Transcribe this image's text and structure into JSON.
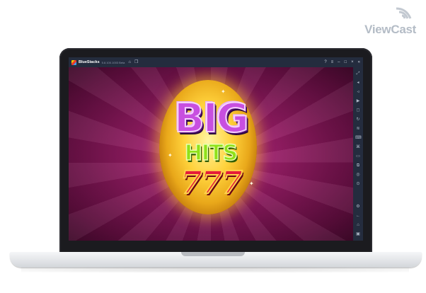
{
  "watermark": {
    "text": "ViewCast"
  },
  "emulator": {
    "app_name": "BlueStacks",
    "version": "5.8.100.1003 Beta",
    "titlebar_icons": [
      "home-icon",
      "multi-instance-icon"
    ],
    "window_controls": [
      "help-icon",
      "menu-icon",
      "minimize-icon",
      "maximize-icon",
      "close-icon",
      "collapse-sidebar-icon"
    ],
    "sidebar_icons": [
      "fullscreen-icon",
      "volume-up-icon",
      "volume-down-icon",
      "screen-record-icon",
      "screenshot-icon",
      "rotate-icon",
      "shake-icon",
      "keyboard-controls-icon",
      "macro-icon",
      "folder-icon",
      "multi-instance-sync-icon",
      "eco-mode-icon",
      "location-icon",
      "settings-icon",
      "back-icon",
      "home-icon",
      "recent-apps-icon"
    ]
  },
  "game": {
    "logo_line1": "BIG",
    "logo_line2": "HITS",
    "logo_line3": "777",
    "colors": {
      "background": "#8c1a5e",
      "gold": "#ffd23c",
      "purple": "#c84fe0",
      "green": "#8fe11a",
      "red": "#e61c3a"
    }
  }
}
